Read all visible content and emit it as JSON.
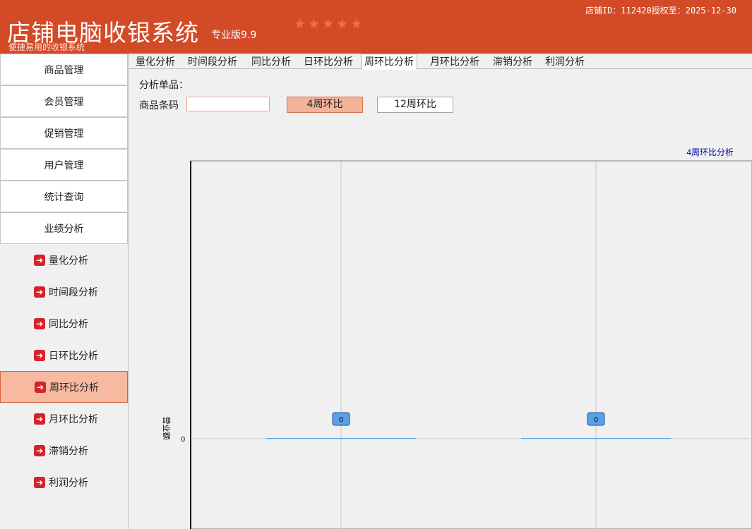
{
  "header": {
    "title": "店铺电脑收银系统",
    "edition": "专业版9.9",
    "tagline": "便捷易用的收银系统",
    "store_info": "店铺ID：112420授权至：2025-12-30",
    "rating": 5
  },
  "sidebar": {
    "menu": [
      "商品管理",
      "会员管理",
      "促销管理",
      "用户管理",
      "统计查询",
      "业绩分析"
    ],
    "sub_items": [
      "量化分析",
      "时间段分析",
      "同比分析",
      "日环比分析",
      "周环比分析",
      "月环比分析",
      "滞销分析",
      "利润分析"
    ],
    "active_sub": "周环比分析"
  },
  "tabs": [
    "量化分析",
    "时间段分析",
    "同比分析",
    "日环比分析",
    "周环比分析",
    "月环比分析",
    "滞销分析",
    "利润分析"
  ],
  "active_tab": "周环比分析",
  "panel": {
    "single_label": "分析单品：",
    "barcode_label": "商品条码",
    "barcode_value": "",
    "btn_4w": "4周环比",
    "btn_12w": "12周环比"
  },
  "chart_data": {
    "type": "bar",
    "legend": [
      "4周环比分析"
    ],
    "ylabel": "营业额",
    "yticks": [
      "0"
    ],
    "series": [
      {
        "name": "4周环比分析",
        "values": [
          0,
          0
        ],
        "labels": [
          "0",
          "0"
        ]
      }
    ],
    "colors": {
      "series": "#5aa0e6",
      "legend": "#0000b0"
    }
  }
}
